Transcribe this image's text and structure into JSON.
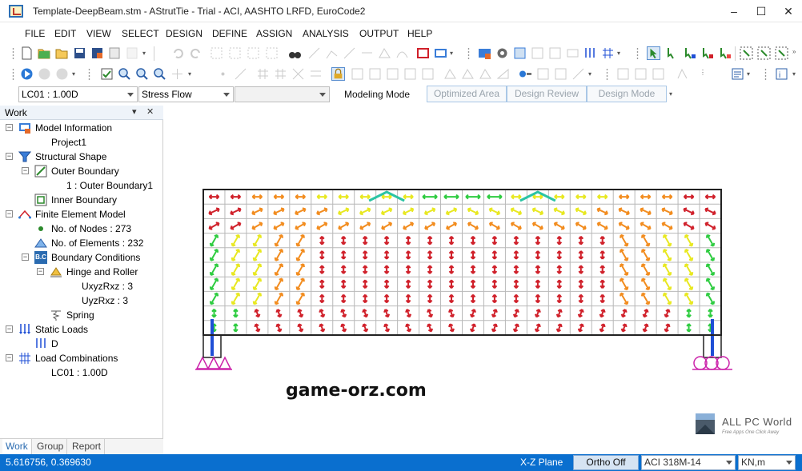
{
  "window": {
    "title": "Template-DeepBeam.stm - AStrutTie - Trial - ACI, AASHTO LRFD, EuroCode2",
    "controls": [
      "minimize-icon",
      "maximize-icon",
      "close-icon"
    ]
  },
  "menu": {
    "items": [
      "FILE",
      "EDIT",
      "VIEW",
      "SELECT",
      "DESIGN",
      "DEFINE",
      "ASSIGN",
      "ANALYSIS",
      "OUTPUT",
      "HELP"
    ]
  },
  "modebar": {
    "load_case": "LC01 : 1.00D",
    "result_type": "Stress Flow",
    "third_combo": "",
    "mode_label": "Modeling Mode",
    "mode_buttons": [
      "Optimized Area",
      "Design Review",
      "Design Mode"
    ]
  },
  "work_panel": {
    "title": "Work",
    "pin_glyph": "▾",
    "pin_icon": "pin-icon",
    "close_glyph": "✕",
    "tree": [
      {
        "label": "Model Information",
        "icon": "model-info-icon"
      },
      {
        "label": "Project1"
      },
      {
        "label": "Structural Shape",
        "icon": "structural-shape-icon"
      },
      {
        "label": "Outer Boundary",
        "icon": "outer-boundary-icon"
      },
      {
        "label": "1 : Outer Boundary1"
      },
      {
        "label": "Inner Boundary",
        "icon": "inner-boundary-icon"
      },
      {
        "label": "Finite Element Model",
        "icon": "fem-icon"
      },
      {
        "label": "No. of Nodes : 273",
        "icon": "node-dot-icon"
      },
      {
        "label": "No. of Elements : 232",
        "icon": "element-triangle-icon"
      },
      {
        "label": "Boundary Conditions",
        "icon": "boundary-conditions-icon",
        "badge": "B.C"
      },
      {
        "label": "Hinge and Roller",
        "icon": "hinge-roller-icon"
      },
      {
        "label": "UxyzRxz : 3"
      },
      {
        "label": "UyzRxz : 3"
      },
      {
        "label": "Spring",
        "icon": "spring-icon"
      },
      {
        "label": "Static Loads",
        "icon": "static-loads-icon"
      },
      {
        "label": "D",
        "icon": "load-d-icon"
      },
      {
        "label": "Load Combinations",
        "icon": "load-combinations-icon"
      },
      {
        "label": "LC01 : 1.00D"
      }
    ],
    "tabs": [
      "Work",
      "Group",
      "Report"
    ]
  },
  "canvas": {
    "watermark": "game-orz.com",
    "logo_name": "ALL PC World",
    "logo_tagline": "Free Apps One Click Away",
    "mesh_colors": {
      "outline": "#222222",
      "grid": "#b8b8b8",
      "compression_high": "#2ecc40",
      "compression_mid": "#e8e820",
      "compression_low": "#f28c1e",
      "tension": "#d0202a",
      "peak": "#2bc4a4",
      "support": "#cc22aa",
      "support_load": "#1f4fd6"
    }
  },
  "status": {
    "coords": "5.616756, 0.369630",
    "plane": "X-Z Plane",
    "ortho": "Ortho Off",
    "code": "ACI 318M-14",
    "units": "KN,m"
  }
}
